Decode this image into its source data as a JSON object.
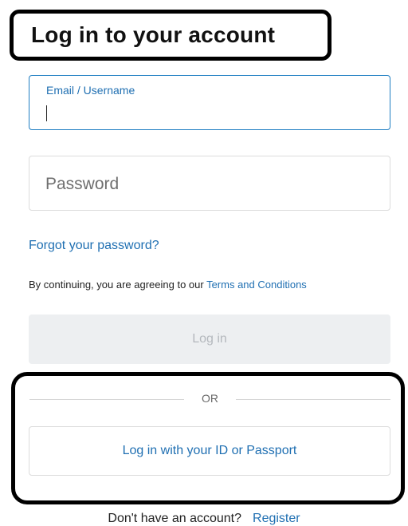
{
  "header": {
    "title": "Log in to your account"
  },
  "form": {
    "email_label": "Email / Username",
    "email_value": "",
    "password_placeholder": "Password",
    "forgot_link": "Forgot your password?",
    "terms_prefix": "By continuing, you are agreeing to our ",
    "terms_link": "Terms and Conditions",
    "login_button": "Log in"
  },
  "alternative": {
    "divider_text": "OR",
    "id_button": "Log in with your ID or Passport"
  },
  "footer": {
    "prompt": "Don't have an account?",
    "register_link": "Register"
  },
  "colors": {
    "accent": "#1f6fb2",
    "focus_border": "#1f7ec2",
    "disabled_bg": "#edeff1",
    "disabled_text": "#b4b8bd"
  }
}
